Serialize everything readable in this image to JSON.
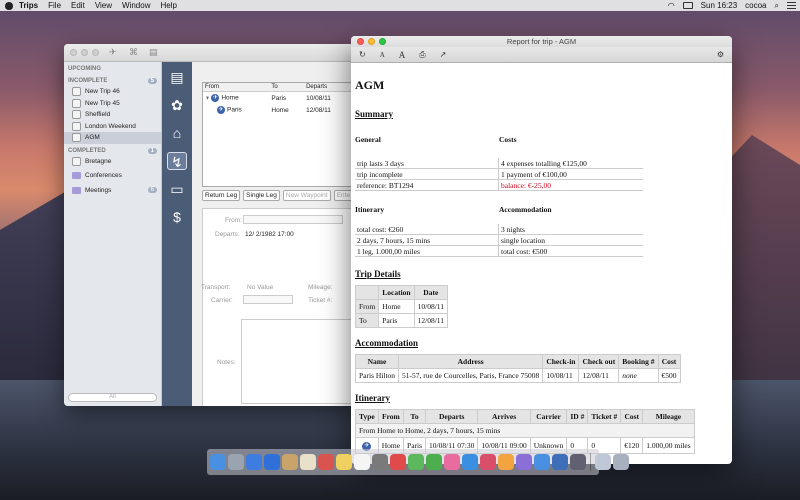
{
  "menubar": {
    "app_name": "Trips",
    "items": [
      "File",
      "Edit",
      "View",
      "Window",
      "Help"
    ],
    "clock": "Sun 16:23",
    "user": "cocoa"
  },
  "trips_window": {
    "sidebar": {
      "upcoming_label": "UPCOMING",
      "incomplete_label": "INCOMPLETE",
      "incomplete_count": "5",
      "incomplete_items": [
        "New Trip 46",
        "New Trip 45",
        "Sheffield",
        "London Weekend",
        "AGM"
      ],
      "selected_item": "AGM",
      "completed_label": "COMPLETED",
      "completed_count": "1",
      "completed_items": [
        "Bretagne"
      ],
      "groups": [
        {
          "name": "Conferences",
          "count": ""
        },
        {
          "name": "Meetings",
          "count": "6"
        }
      ],
      "search_placeholder": "All"
    },
    "legs": {
      "columns": [
        "From",
        "To",
        "Departs"
      ],
      "rows": [
        {
          "from": "Home",
          "to": "Paris",
          "departs": "10/08/11"
        },
        {
          "from": "Paris",
          "to": "Home",
          "departs": "12/08/11"
        }
      ],
      "buttons": [
        "Return Leg",
        "Single Leg",
        "New Waypoint",
        "Ente"
      ]
    },
    "form": {
      "from_label": "From:",
      "departs_label": "Departs:",
      "departs_value": "12/  2/1982 17:00",
      "transport_label": "Transport:",
      "transport_value": "No Value",
      "carrier_label": "Carrier:",
      "mileage_label": "Mileage:",
      "ticket_label": "Ticket #:",
      "notes_label": "Notes:"
    }
  },
  "report_window": {
    "title": "Report for trip - AGM",
    "heading": "AGM",
    "summary": {
      "heading": "Summary",
      "general_label": "General",
      "costs_label": "Costs",
      "rows": [
        [
          "trip lasts 3 days",
          "4 expenses totalling €125,00"
        ],
        [
          "trip incomplete",
          "1 payment of €100,00"
        ],
        [
          "reference: BT1294",
          "balance: €-25,00"
        ]
      ],
      "itinerary_label": "Itinerary",
      "accommodation_label": "Accommodation",
      "rows2": [
        [
          "total cost: €260",
          "3 nights"
        ],
        [
          "2 days, 7 hours, 15 mins",
          "single location"
        ],
        [
          "1 leg, 1.000,00 miles",
          "total cost: €500"
        ]
      ],
      "negative_color": "#d0021b"
    },
    "trip_details": {
      "heading": "Trip Details",
      "columns": [
        "",
        "Location",
        "Date"
      ],
      "rows": [
        [
          "From",
          "Home",
          "10/08/11"
        ],
        [
          "To",
          "Paris",
          "12/08/11"
        ]
      ]
    },
    "accommodation": {
      "heading": "Accommodation",
      "columns": [
        "Name",
        "Address",
        "Check-in",
        "Check out",
        "Booking #",
        "Cost"
      ],
      "rows": [
        [
          "Paris Hilton",
          "51-57, rue de Courcelles, Paris, France 75008",
          "10/08/11",
          "12/08/11",
          "none",
          "€500"
        ]
      ]
    },
    "itinerary": {
      "heading": "Itinerary",
      "columns": [
        "Type",
        "From",
        "To",
        "Departs",
        "Arrives",
        "Carrier",
        "ID #",
        "Ticket #",
        "Cost",
        "Mileage"
      ],
      "group_row": "From Home to Home, 2 days, 7 hours, 15 mins",
      "rows": [
        [
          "",
          "Home",
          "Paris",
          "10/08/11 07:30",
          "10/08/11 09:00",
          "Unknown",
          "0",
          "0",
          "€120",
          "1.000,00 miles"
        ]
      ]
    }
  },
  "dock": {
    "icon_colors": [
      "#4a90e2",
      "#9aa4b0",
      "#3d7de0",
      "#2f6fd8",
      "#c8a46a",
      "#e8e0c8",
      "#d9534f",
      "#f0d060",
      "#f5f5f5",
      "#7a7a7a",
      "#e04a4a",
      "#5cb85c",
      "#4cae4c",
      "#e86ca0",
      "#3b8fe0",
      "#d94f6a",
      "#f2a440",
      "#8a6fd6",
      "#4a90e2",
      "#3d6fb8",
      "#606070",
      "#c0c8d8",
      "#a8b0c0"
    ]
  }
}
